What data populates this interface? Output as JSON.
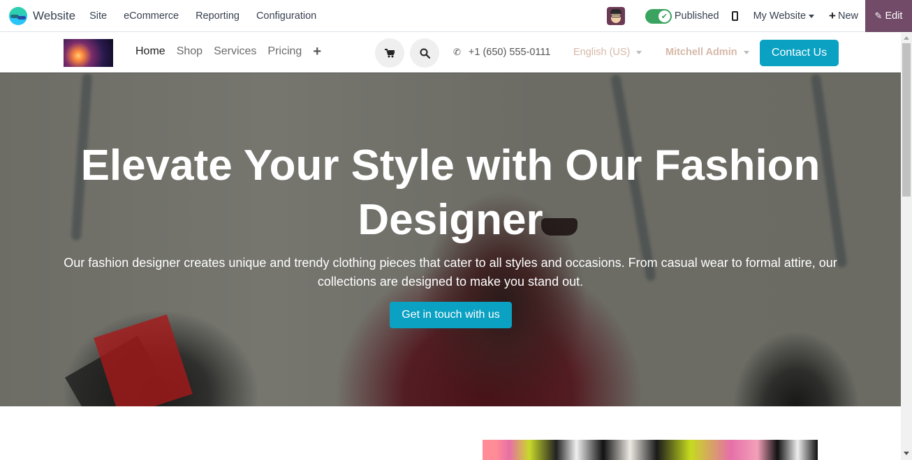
{
  "topbar": {
    "app_name": "Website",
    "menu": [
      "Site",
      "eCommerce",
      "Reporting",
      "Configuration"
    ],
    "published_label": "Published",
    "published": true,
    "my_website_label": "My Website",
    "new_label": "New",
    "edit_label": "Edit",
    "icons": {
      "app_logo": "odoo-website-logo",
      "avatar": "user-avatar",
      "toggle_check": "✔",
      "mobile": "mobile-preview-icon",
      "plus": "+",
      "pencil": "✎"
    },
    "colors": {
      "edit_bg": "#714b67",
      "toggle_on": "#3aa35f"
    }
  },
  "site_header": {
    "nav": [
      {
        "label": "Home",
        "active": true
      },
      {
        "label": "Shop",
        "active": false
      },
      {
        "label": "Services",
        "active": false
      },
      {
        "label": "Pricing",
        "active": false
      }
    ],
    "add_menu_icon": "+",
    "cart_icon": "🛒",
    "search_icon": "⌕",
    "phone_icon": "✆",
    "phone": "+1 (650) 555-0111",
    "language": "English (US)",
    "user": "Mitchell Admin",
    "contact_label": "Contact Us",
    "colors": {
      "primary": "#0aa1c3",
      "muted_link": "#d6b8a8"
    }
  },
  "hero": {
    "title": "Elevate Your Style with Our Fashion Designer",
    "subtitle": "Our fashion designer creates unique and trendy clothing pieces that cater to all styles and occasions. From casual wear to formal attire, our collections are designed to make you stand out.",
    "cta_label": "Get in touch with us"
  }
}
